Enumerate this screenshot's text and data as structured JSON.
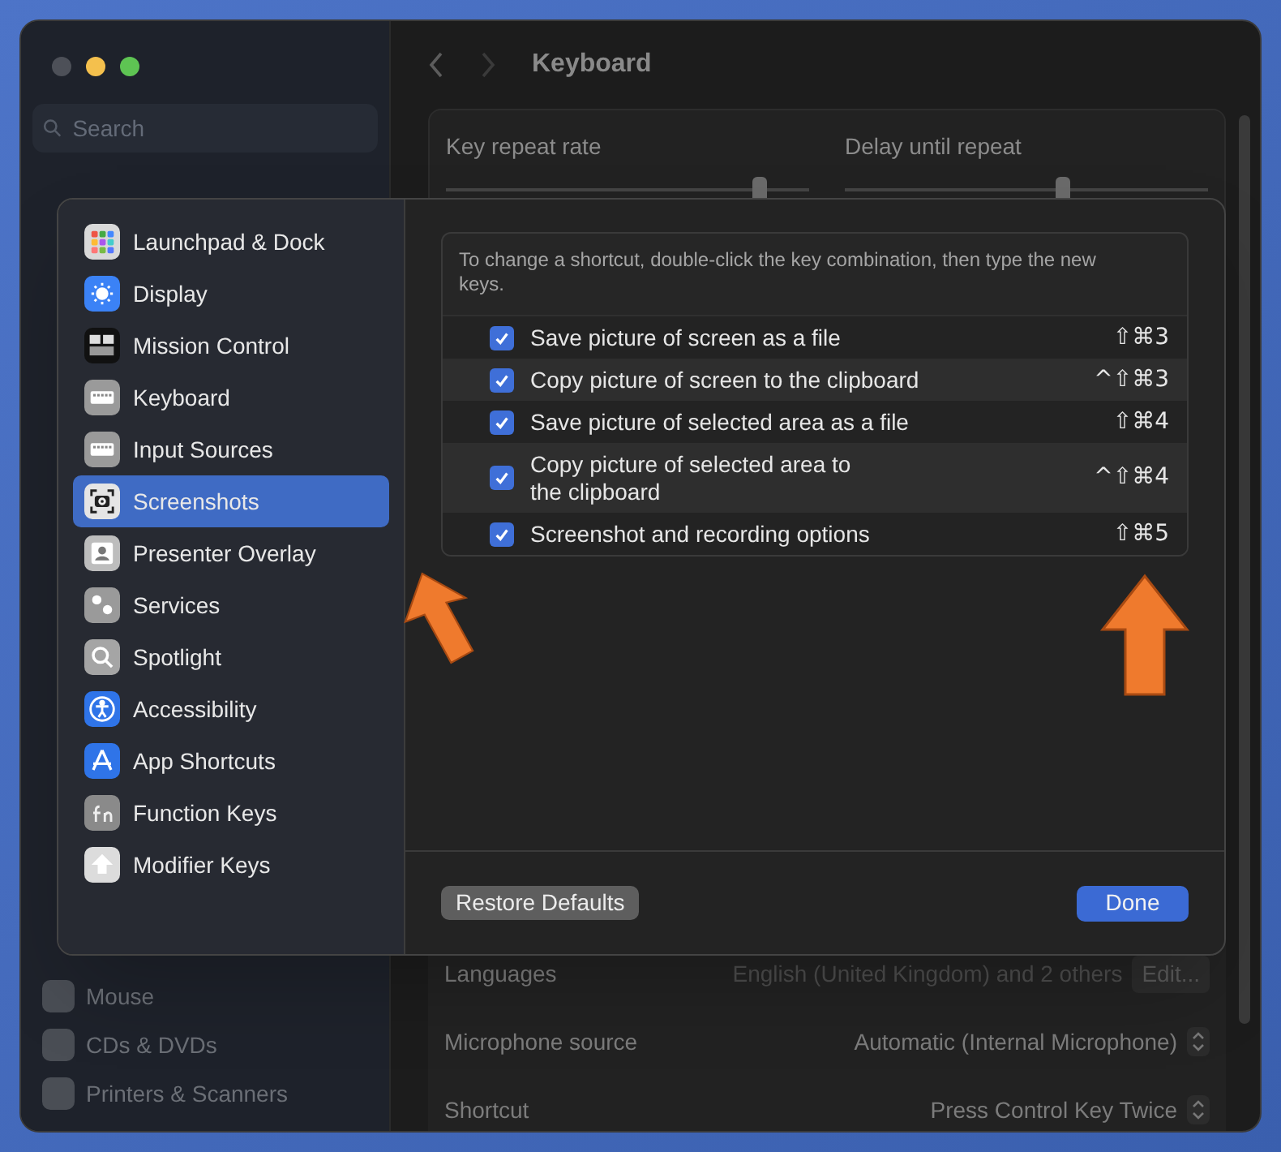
{
  "window": {
    "title": "Keyboard"
  },
  "sidebar": {
    "search": {
      "placeholder": "Search"
    },
    "items": [
      {
        "label": "Mouse"
      },
      {
        "label": "CDs & DVDs"
      },
      {
        "label": "Printers & Scanners"
      }
    ]
  },
  "main": {
    "sliders": [
      {
        "label": "Key repeat rate",
        "level": 0.86
      },
      {
        "label": "Delay until repeat",
        "level": 0.6
      }
    ],
    "rows": [
      {
        "label": "Languages",
        "value": "English (United Kingdom) and 2 others",
        "kind": "button",
        "button": "Edit..."
      },
      {
        "label": "Microphone source",
        "value": "Automatic (Internal Microphone)",
        "kind": "popup"
      },
      {
        "label": "Shortcut",
        "value": "Press Control Key Twice",
        "kind": "popup"
      }
    ]
  },
  "sheet": {
    "categories": [
      {
        "label": "Launchpad & Dock",
        "selected": false
      },
      {
        "label": "Display",
        "selected": false
      },
      {
        "label": "Mission Control",
        "selected": false
      },
      {
        "label": "Keyboard",
        "selected": false
      },
      {
        "label": "Input Sources",
        "selected": false
      },
      {
        "label": "Screenshots",
        "selected": true
      },
      {
        "label": "Presenter Overlay",
        "selected": false
      },
      {
        "label": "Services",
        "selected": false
      },
      {
        "label": "Spotlight",
        "selected": false
      },
      {
        "label": "Accessibility",
        "selected": false
      },
      {
        "label": "App Shortcuts",
        "selected": false
      },
      {
        "label": "Function Keys",
        "selected": false
      },
      {
        "label": "Modifier Keys",
        "selected": false
      }
    ],
    "hint": "To change a shortcut, double-click the key combination, then type the new keys.",
    "shortcuts": [
      {
        "label": "Save picture of screen as a file",
        "keys": "⇧⌘3",
        "checked": true
      },
      {
        "label": "Copy picture of screen to the clipboard",
        "keys": "^⇧⌘3",
        "checked": true
      },
      {
        "label": "Save picture of selected area as a file",
        "keys": "⇧⌘4",
        "checked": true
      },
      {
        "label": "Copy picture of selected area to\nthe clipboard",
        "keys": "^⇧⌘4",
        "checked": true
      },
      {
        "label": "Screenshot and recording options",
        "keys": "⇧⌘5",
        "checked": true
      }
    ],
    "buttons": {
      "restore": "Restore Defaults",
      "done": "Done"
    }
  }
}
